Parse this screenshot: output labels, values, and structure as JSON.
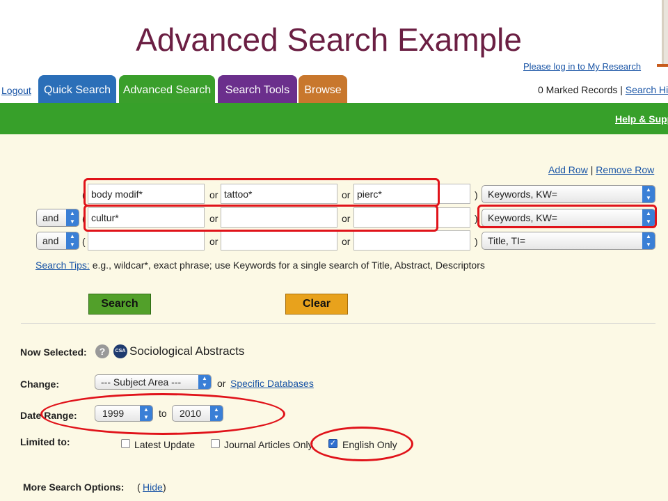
{
  "slide": {
    "title": "Advanced Search Example"
  },
  "header": {
    "login_link": "Please log in to My Research",
    "logout": "Logout",
    "tabs": [
      "Quick Search",
      "Advanced Search",
      "Search Tools",
      "Browse"
    ],
    "marked_records": "0 Marked Records |",
    "search_history": "Search History",
    "help": "Help & Support"
  },
  "search": {
    "add_row": "Add Row",
    "separator": "|",
    "remove_row": "Remove Row",
    "open_paren": "(",
    "close_paren": ")",
    "or_label": "or",
    "rows": [
      {
        "bool": "",
        "terms": [
          "body modif*",
          "tattoo*",
          "pierc*"
        ],
        "field": "Keywords, KW="
      },
      {
        "bool": "and",
        "terms": [
          "cultur*",
          "",
          ""
        ],
        "field": "Keywords, KW="
      },
      {
        "bool": "and",
        "terms": [
          "",
          "",
          ""
        ],
        "field": "Title, TI="
      }
    ],
    "tips_link": "Search Tips:",
    "tips_text": "e.g., wildcar*, exact phrase; use Keywords for a single search of Title, Abstract, Descriptors",
    "search_button": "Search",
    "clear_button": "Clear"
  },
  "options": {
    "now_selected_label": "Now Selected:",
    "help_icon": "?",
    "db_badge": "CSA",
    "database": "Sociological Abstracts",
    "change_label": "Change:",
    "subject_area": "--- Subject Area ---",
    "or_text": "or",
    "specific_databases": "Specific Databases",
    "date_range_label": "Date Range:",
    "date_from": "1999",
    "to_text": "to",
    "date_to": "2010",
    "limited_label": "Limited to:",
    "limits": [
      {
        "label": "Latest Update",
        "checked": false
      },
      {
        "label": "Journal Articles Only",
        "checked": false
      },
      {
        "label": "English Only",
        "checked": true
      }
    ],
    "more_label": "More Search Options:",
    "hide_open": "(",
    "hide_link": "Hide",
    "hide_close": ")"
  },
  "colors": {
    "title": "#6b1f43",
    "tab_quick": "#2b6fb8",
    "tab_advanced": "#3a9f2b",
    "tab_tools": "#6b2f8c",
    "tab_browse": "#c8772d",
    "green_bar": "#37a02a",
    "highlight": "#e0131a"
  }
}
